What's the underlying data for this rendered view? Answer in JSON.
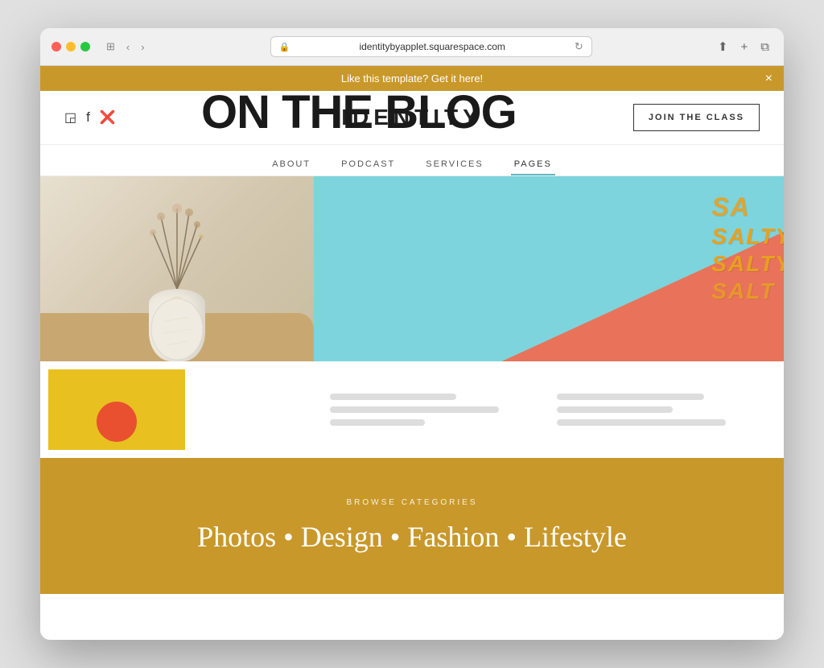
{
  "browser": {
    "address": "identitybyapplet.squarespace.com",
    "back_label": "‹",
    "forward_label": "›",
    "window_icon": "⊞",
    "share_label": "⬆",
    "add_tab_label": "+",
    "duplicate_label": "⧉"
  },
  "banner": {
    "text": "Like this template? Get it here!",
    "close_label": "×"
  },
  "header": {
    "site_title": "IDENTITY",
    "cta_label": "JOIN THE CLASS",
    "social": {
      "instagram_label": "instagram-icon",
      "facebook_label": "facebook-icon",
      "pinterest_label": "pinterest-icon"
    }
  },
  "nav": {
    "items": [
      {
        "label": "ABOUT",
        "active": false
      },
      {
        "label": "PODCAST",
        "active": false
      },
      {
        "label": "SERVICES",
        "active": false
      },
      {
        "label": "PAGES",
        "active": true
      }
    ]
  },
  "hero": {
    "blog_title": "ON THE BLOG",
    "salty_lines": [
      "SA",
      "SALTY",
      "SALTY",
      "SALT"
    ]
  },
  "browse": {
    "label": "BROWSE CATEGORIES",
    "categories": "Photos • Design • Fashion • Lifestyle"
  }
}
